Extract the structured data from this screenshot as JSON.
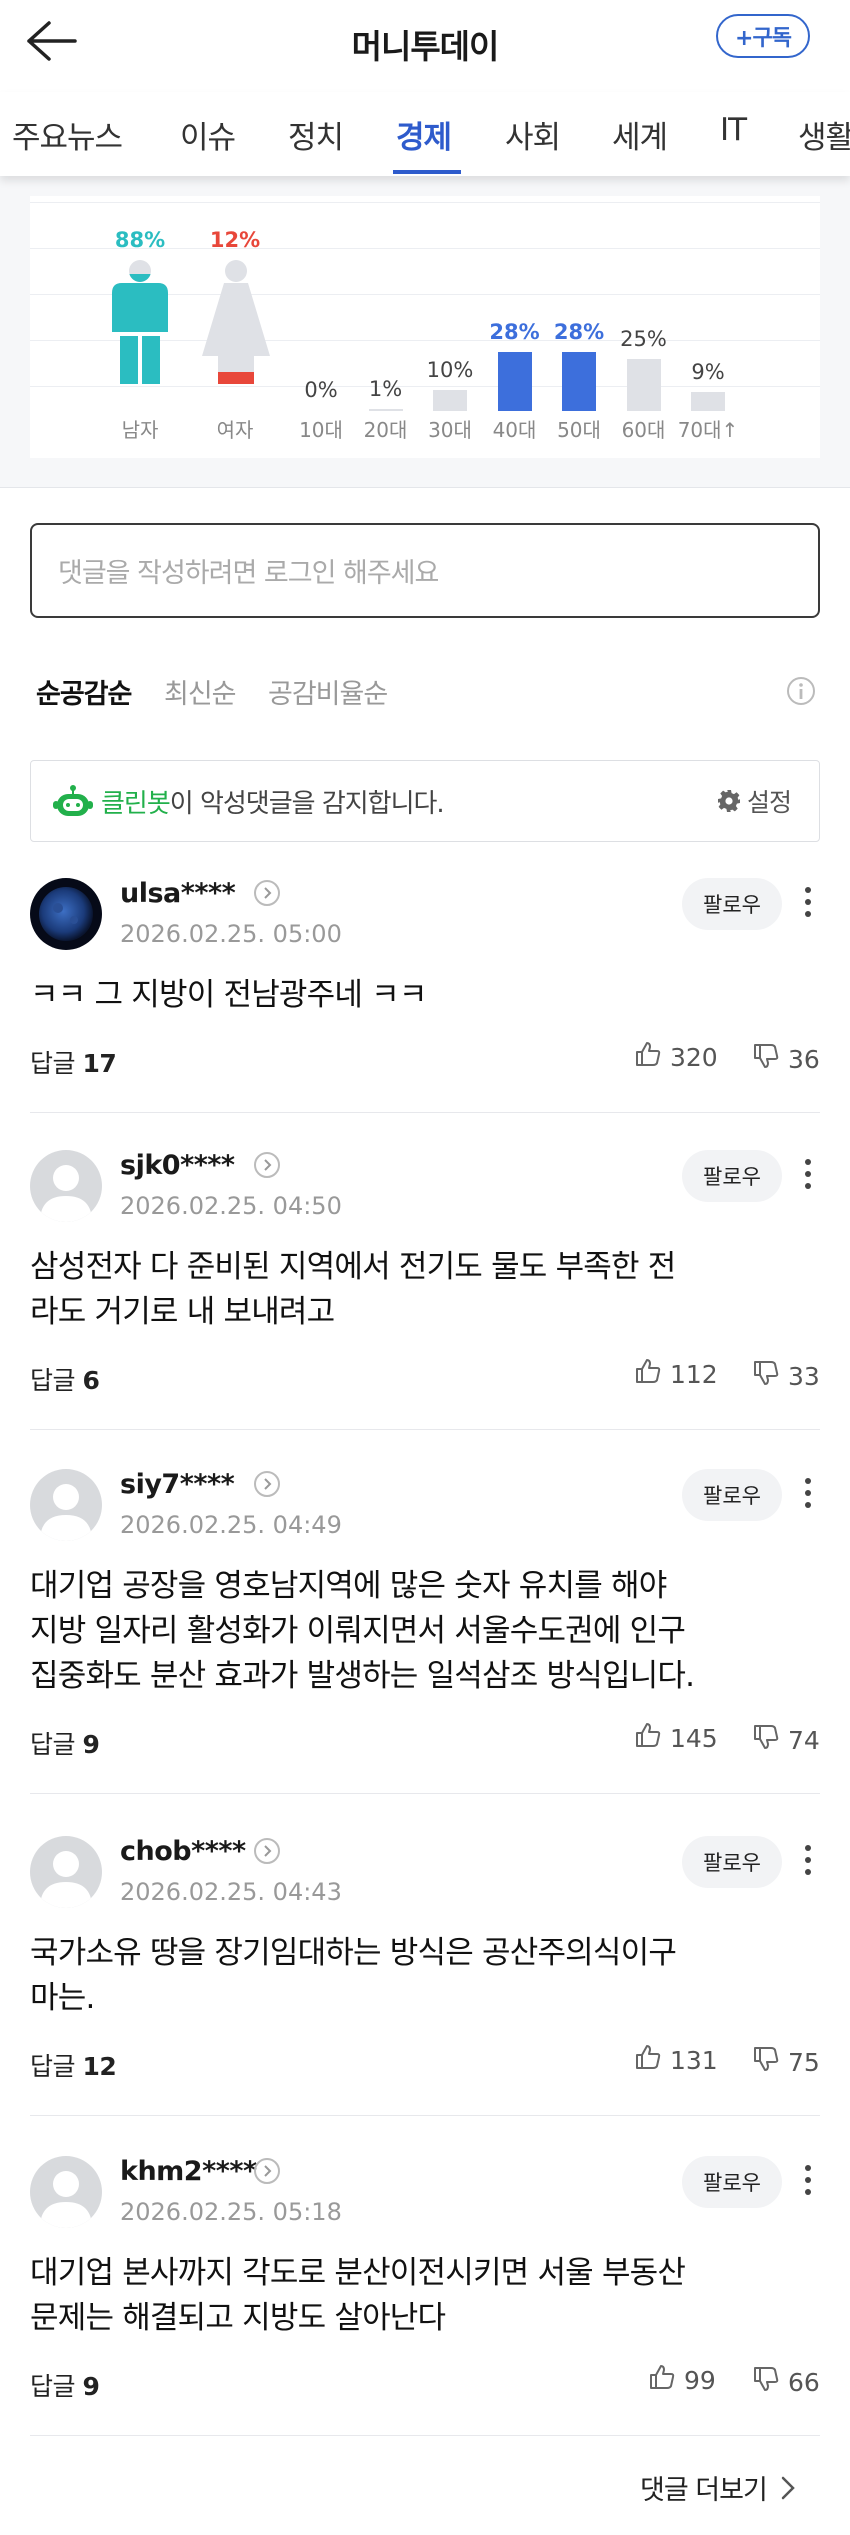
{
  "header": {
    "title": "머니투데이",
    "subscribe_label": "+구독"
  },
  "tabs": [
    "주요뉴스",
    "이슈",
    "정치",
    "경제",
    "사회",
    "세계",
    "IT",
    "생활"
  ],
  "active_tab": "경제",
  "stats": {
    "gender": [
      {
        "label": "남자",
        "pct": "88%",
        "color": "#2bbdc1"
      },
      {
        "label": "여자",
        "pct": "12%",
        "color": "#e8473a"
      }
    ],
    "age": [
      {
        "label": "10대",
        "pct": "0%",
        "value": 0,
        "highlight": false
      },
      {
        "label": "20대",
        "pct": "1%",
        "value": 1,
        "highlight": false
      },
      {
        "label": "30대",
        "pct": "10%",
        "value": 10,
        "highlight": false
      },
      {
        "label": "40대",
        "pct": "28%",
        "value": 28,
        "highlight": true
      },
      {
        "label": "50대",
        "pct": "28%",
        "value": 28,
        "highlight": true
      },
      {
        "label": "60대",
        "pct": "25%",
        "value": 25,
        "highlight": false
      },
      {
        "label": "70대↑",
        "pct": "9%",
        "value": 9,
        "highlight": false
      }
    ],
    "highlight_color": "#3d6fdc",
    "bar_color": "#dfe1e6"
  },
  "comment_input": {
    "placeholder": "댓글을 작성하려면 로그인 해주세요"
  },
  "sort": {
    "options": [
      "순공감순",
      "최신순",
      "공감비율순"
    ],
    "active": "순공감순"
  },
  "cleanbot": {
    "name": "클린봇",
    "message": "이 악성댓글을 감지합니다.",
    "settings_label": "설정"
  },
  "comments": [
    {
      "user": "ulsa****",
      "date": "2026.02.25. 05:00",
      "follow": "팔로우",
      "lines": [
        "ㅋㅋ 그 지방이 전남광주네 ㅋㅋ"
      ],
      "reply_label": "답글",
      "replies": "17",
      "likes": "320",
      "dislikes": "36",
      "avatar": "moon"
    },
    {
      "user": "sjk0****",
      "date": "2026.02.25. 04:50",
      "follow": "팔로우",
      "lines": [
        "삼성전자 다 준비된 지역에서 전기도 물도 부족한 전",
        "라도 거기로 내 보내려고"
      ],
      "reply_label": "답글",
      "replies": "6",
      "likes": "112",
      "dislikes": "33",
      "avatar": "default"
    },
    {
      "user": "siy7****",
      "date": "2026.02.25. 04:49",
      "follow": "팔로우",
      "lines": [
        "대기업 공장을 영호남지역에 많은 숫자 유치를 해야",
        "지방 일자리 활성화가 이뤄지면서 서울수도권에 인구",
        "집중화도 분산 효과가 발생하는 일석삼조 방식입니다."
      ],
      "reply_label": "답글",
      "replies": "9",
      "likes": "145",
      "dislikes": "74",
      "avatar": "default"
    },
    {
      "user": "chob****",
      "date": "2026.02.25. 04:43",
      "follow": "팔로우",
      "lines": [
        "국가소유 땅을 장기임대하는 방식은 공산주의식이구",
        "마는."
      ],
      "reply_label": "답글",
      "replies": "12",
      "likes": "131",
      "dislikes": "75",
      "avatar": "default"
    },
    {
      "user": "khm2****",
      "date": "2026.02.25. 05:18",
      "follow": "팔로우",
      "lines": [
        "대기업 본사까지 각도로 분산이전시키면 서울 부동산",
        "문제는 해결되고 지방도 살아난다"
      ],
      "reply_label": "답글",
      "replies": "9",
      "likes": "99",
      "dislikes": "66",
      "avatar": "default"
    }
  ],
  "more_comments_label": "댓글 더보기"
}
